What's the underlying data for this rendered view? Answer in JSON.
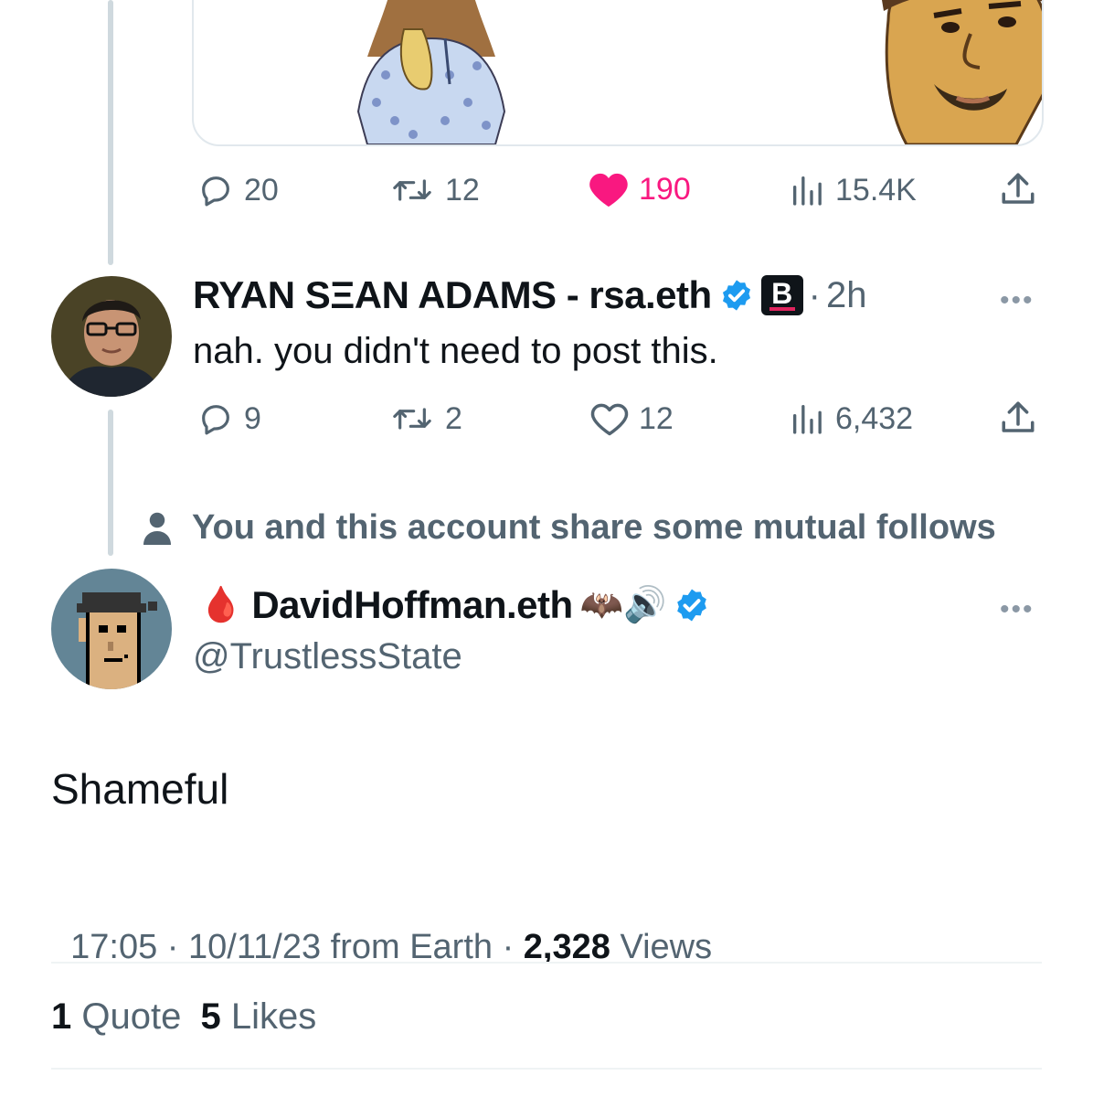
{
  "top_tweet": {
    "actions": {
      "replies": "20",
      "retweets": "12",
      "likes": "190",
      "views": "15.4K"
    },
    "like_color": "#f91880"
  },
  "reply": {
    "name": "RYAN SΞAN ADAMS - rsa.eth",
    "badge_letter": "B",
    "time_separator": "·",
    "time": "2h",
    "more": "•••",
    "text": "nah. you didn't need to post this.",
    "actions": {
      "replies": "9",
      "retweets": "2",
      "likes": "12",
      "views": "6,432"
    }
  },
  "mutual_notice": "You and this account share some mutual follows",
  "main_tweet": {
    "name_prefix_emoji": "🩸",
    "name": "DavidHoffman.eth",
    "name_suffix_emojis": "🦇🔊",
    "handle": "@TrustlessState",
    "more": "•••",
    "text": "Shameful",
    "timestamp": "17:05 · 10/11/23 from Earth · ",
    "views_count": "2,328",
    "views_label": " Views",
    "quotes_count": "1",
    "quotes_label": "Quote",
    "likes_count": "5",
    "likes_label": "Likes"
  },
  "colors": {
    "verified": "#1d9bf0",
    "secondary_text": "#536471",
    "divider": "#eff3f4",
    "thread_line": "#cfd9de"
  }
}
